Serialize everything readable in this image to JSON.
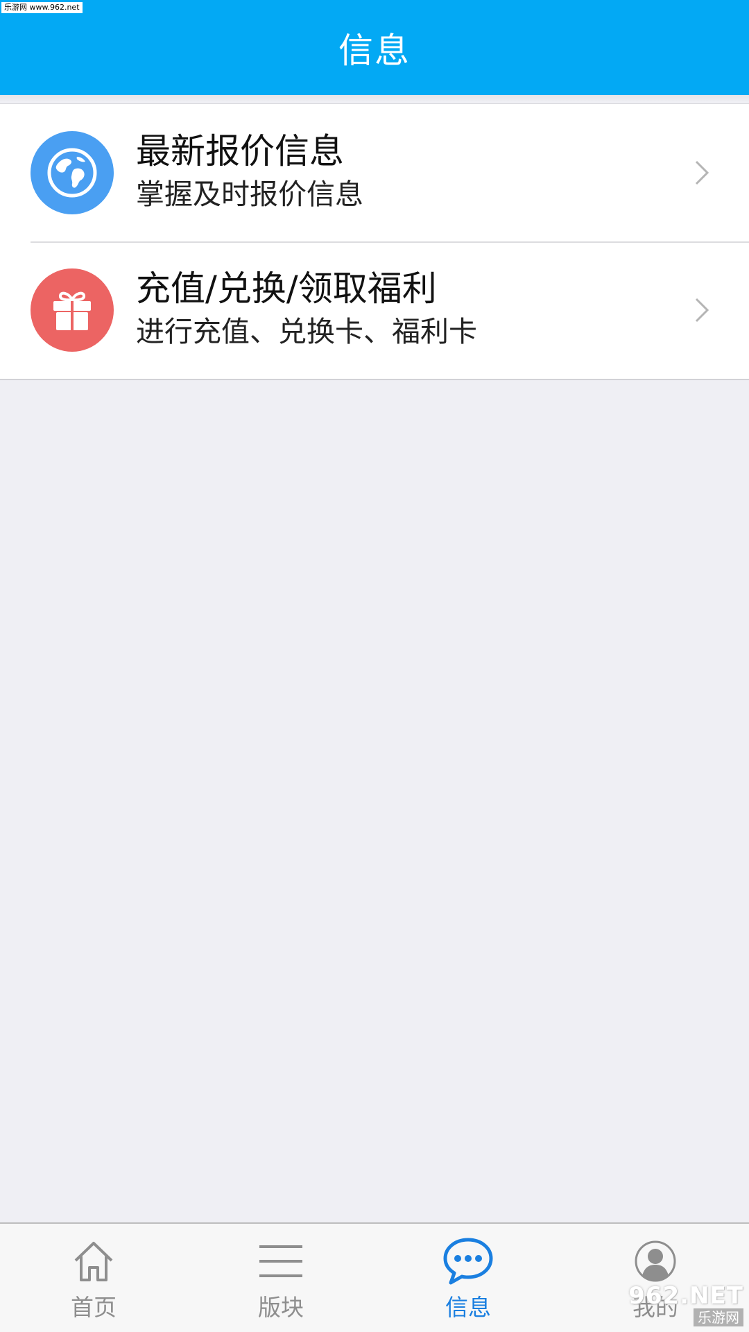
{
  "watermark_top": "乐游网 www.962.net",
  "header": {
    "title": "信息"
  },
  "list": {
    "items": [
      {
        "title": "最新报价信息",
        "subtitle": "掌握及时报价信息",
        "icon": "globe-icon",
        "icon_color": "#4a9ff2"
      },
      {
        "title": "充值/兑换/领取福利",
        "subtitle": "进行充值、兑换卡、福利卡",
        "icon": "gift-icon",
        "icon_color": "#ec6463"
      }
    ]
  },
  "tabbar": {
    "active_index": 2,
    "active_color": "#1a7fe0",
    "inactive_color": "#8e8e8e",
    "tabs": [
      {
        "label": "首页",
        "icon": "home-icon"
      },
      {
        "label": "版块",
        "icon": "menu-lines-icon"
      },
      {
        "label": "信息",
        "icon": "chat-bubble-icon"
      },
      {
        "label": "我的",
        "icon": "user-avatar-icon"
      }
    ]
  },
  "watermark_bottom": {
    "logo": "962.NET",
    "sub": "乐游网"
  },
  "colors": {
    "header_bg": "#03a9f4",
    "page_bg": "#efeff4"
  }
}
